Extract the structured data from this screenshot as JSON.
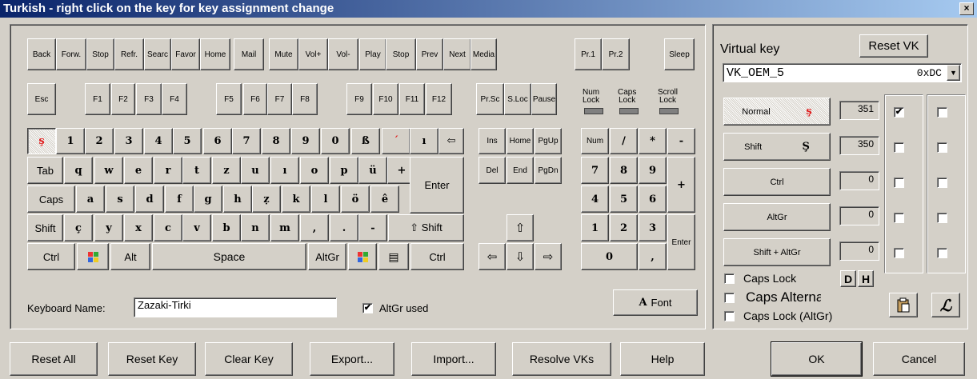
{
  "window": {
    "title": "Turkish - right click on the key for key assignment change",
    "close_label": "×"
  },
  "media_keys": [
    "Back",
    "Forw.",
    "Stop",
    "Refr.",
    "Searc",
    "Favor",
    "Home",
    "Mail",
    "Mute",
    "Vol+",
    "Vol-",
    "Play",
    "Stop",
    "Prev",
    "Next",
    "Media",
    "Pr.1",
    "Pr.2",
    "Sleep"
  ],
  "fkeys": [
    "Esc",
    "F1",
    "F2",
    "F3",
    "F4",
    "F5",
    "F6",
    "F7",
    "F8",
    "F9",
    "F10",
    "F11",
    "F12",
    "Pr.Sc",
    "S.Loc",
    "Pause"
  ],
  "locks": [
    {
      "line1": "Num",
      "line2": "Lock"
    },
    {
      "line1": "Caps",
      "line2": "Lock"
    },
    {
      "line1": "Scroll",
      "line2": "Lock"
    }
  ],
  "row1": [
    "ş",
    "1",
    "2",
    "3",
    "4",
    "5",
    "6",
    "7",
    "8",
    "9",
    "0",
    "ß",
    "´",
    "ı",
    "⇦"
  ],
  "row2": [
    "Tab",
    "q",
    "w",
    "e",
    "r",
    "t",
    "z",
    "u",
    "ı",
    "o",
    "p",
    "ü",
    "+",
    "Enter"
  ],
  "row3": [
    "Caps",
    "a",
    "s",
    "d",
    "f",
    "g",
    "h",
    "ẓ",
    "k",
    "l",
    "ö",
    "ê"
  ],
  "row4": [
    "Shift",
    "ç",
    "y",
    "x",
    "c",
    "v",
    "b",
    "n",
    "m",
    ",",
    ".",
    "-",
    "⇧ Shift"
  ],
  "row5": [
    "Ctrl",
    "Alt",
    "Space",
    "AltGr",
    "Ctrl"
  ],
  "nav": [
    "Ins",
    "Home",
    "PgUp",
    "Del",
    "End",
    "PgDn"
  ],
  "arrows": [
    "⇧",
    "⇦",
    "⇩",
    "⇨"
  ],
  "numpad": [
    "Num",
    "/",
    "*",
    "-",
    "7",
    "8",
    "9",
    "+",
    "4",
    "5",
    "6",
    "1",
    "2",
    "3",
    "Enter",
    "0",
    ","
  ],
  "keyboard_name": {
    "label": "Keyboard Name:",
    "value": "Zazaki-Tirki"
  },
  "altgr_used": {
    "label": "AltGr used",
    "checked": true
  },
  "font_button": {
    "icon": "A",
    "label": "Font"
  },
  "right": {
    "virtual_key_label": "Virtual key",
    "reset_vk": "Reset VK",
    "vk_name": "VK_OEM_5",
    "vk_code": "0xDC",
    "states": [
      {
        "label": "Normal",
        "char": "ş",
        "value": "351",
        "check1": true,
        "check2": false
      },
      {
        "label": "Shift",
        "char": "Ş",
        "value": "350",
        "check1": false,
        "check2": false
      },
      {
        "label": "Ctrl",
        "char": "",
        "value": "0",
        "check1": false,
        "check2": false
      },
      {
        "label": "AltGr",
        "char": "",
        "value": "0",
        "check1": false,
        "check2": false
      },
      {
        "label": "Shift + AltGr",
        "char": "",
        "value": "0",
        "check1": false,
        "check2": false
      }
    ],
    "caps_lock": "Caps Lock",
    "caps_alternate": "Caps Alterna",
    "caps_lock_altgr": "Caps Lock (AltGr)",
    "d_label": "D",
    "h_label": "H"
  },
  "bottom_buttons": [
    "Reset All",
    "Reset Key",
    "Clear Key",
    "Export...",
    "Import...",
    "Resolve VKs",
    "Help",
    "OK",
    "Cancel"
  ],
  "colors": {
    "face": "#d4d0c8",
    "title_start": "#0a246a",
    "title_end": "#a6caf0",
    "accent_red": "#e02020"
  }
}
